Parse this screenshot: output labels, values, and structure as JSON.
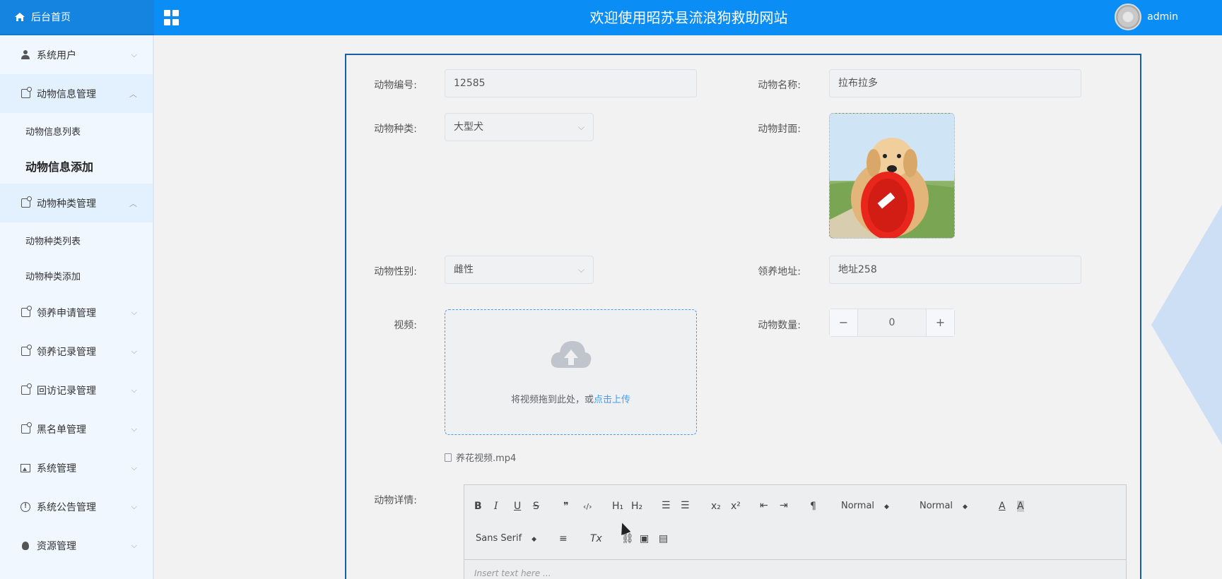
{
  "header": {
    "home_label": "后台首页",
    "site_title": "欢迎使用昭苏县流浪狗救助网站",
    "username": "admin"
  },
  "sidebar": {
    "items": [
      {
        "label": "系统用户",
        "icon": "user-icon",
        "open": false
      },
      {
        "label": "动物信息管理",
        "icon": "tag-icon",
        "open": true,
        "children": [
          {
            "label": "动物信息列表"
          },
          {
            "label": "动物信息添加",
            "active": true
          }
        ]
      },
      {
        "label": "动物种类管理",
        "icon": "tag-icon",
        "open": true,
        "children": [
          {
            "label": "动物种类列表"
          },
          {
            "label": "动物种类添加"
          }
        ]
      },
      {
        "label": "领养申请管理",
        "icon": "tag-icon",
        "open": false
      },
      {
        "label": "领养记录管理",
        "icon": "tag-icon",
        "open": false
      },
      {
        "label": "回访记录管理",
        "icon": "tag-icon",
        "open": false
      },
      {
        "label": "黑名单管理",
        "icon": "tag-icon",
        "open": false
      },
      {
        "label": "系统管理",
        "icon": "image-icon",
        "open": false
      },
      {
        "label": "系统公告管理",
        "icon": "info-icon",
        "open": false
      },
      {
        "label": "资源管理",
        "icon": "bulb-icon",
        "open": false
      }
    ]
  },
  "form": {
    "animal_id": {
      "label": "动物编号:",
      "value": "12585"
    },
    "animal_name": {
      "label": "动物名称:",
      "value": "拉布拉多"
    },
    "animal_type": {
      "label": "动物种类:",
      "value": "大型犬"
    },
    "animal_cover": {
      "label": "动物封面:"
    },
    "animal_gender": {
      "label": "动物性别:",
      "value": "雌性"
    },
    "adopt_address": {
      "label": "领养地址:",
      "value": "地址258"
    },
    "video": {
      "label": "视频:",
      "drop_text": "将视频拖到此处，或",
      "upload_link": "点击上传",
      "file_name": "养花视频.mp4"
    },
    "animal_count": {
      "label": "动物数量:",
      "value": "0",
      "minus": "−",
      "plus": "+"
    },
    "details": {
      "label": "动物详情:",
      "placeholder": "Insert text here ...",
      "toolbar": {
        "bold": "B",
        "italic": "I",
        "underline": "U",
        "strike": "S",
        "blockquote": "❞",
        "code": "‹/›",
        "h1": "H₁",
        "h2": "H₂",
        "header_select": "Normal",
        "size_select": "Normal",
        "font_select": "Sans Serif",
        "sub": "x₂",
        "sup": "x²",
        "clean": "Tx"
      }
    }
  },
  "colors": {
    "topbar": "#0a8df5",
    "accent": "#409eff",
    "panel_border": "#1a5da6"
  }
}
